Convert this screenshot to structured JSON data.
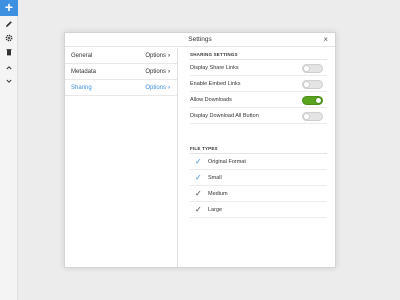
{
  "rail": {
    "add_label": "+",
    "icons": [
      "pencil-icon",
      "gear-icon",
      "trash-icon",
      "chevron-up-icon",
      "chevron-down-icon"
    ]
  },
  "dialog": {
    "title": "Settings",
    "close_label": "×"
  },
  "nav": {
    "items": [
      {
        "label": "General",
        "options": "Options"
      },
      {
        "label": "Metadata",
        "options": "Options"
      },
      {
        "label": "Sharing",
        "options": "Options",
        "active": true
      }
    ]
  },
  "sharing": {
    "section_title": "SHARING SETTINGS",
    "settings": [
      {
        "label": "Display Share Links",
        "on": false
      },
      {
        "label": "Enable Embed Links",
        "on": false
      },
      {
        "label": "Allow Downloads",
        "on": true
      },
      {
        "label": "Display Download All Button",
        "on": false
      }
    ]
  },
  "file_types": {
    "section_title": "FILE TYPES",
    "items": [
      {
        "label": "Original Format",
        "checked": true
      },
      {
        "label": "Small",
        "checked": true
      },
      {
        "label": "Medium",
        "checked": true
      },
      {
        "label": "Large",
        "checked": true
      }
    ]
  },
  "colors": {
    "accent": "#3d8fe0",
    "toggle_on": "#5aa51f"
  }
}
